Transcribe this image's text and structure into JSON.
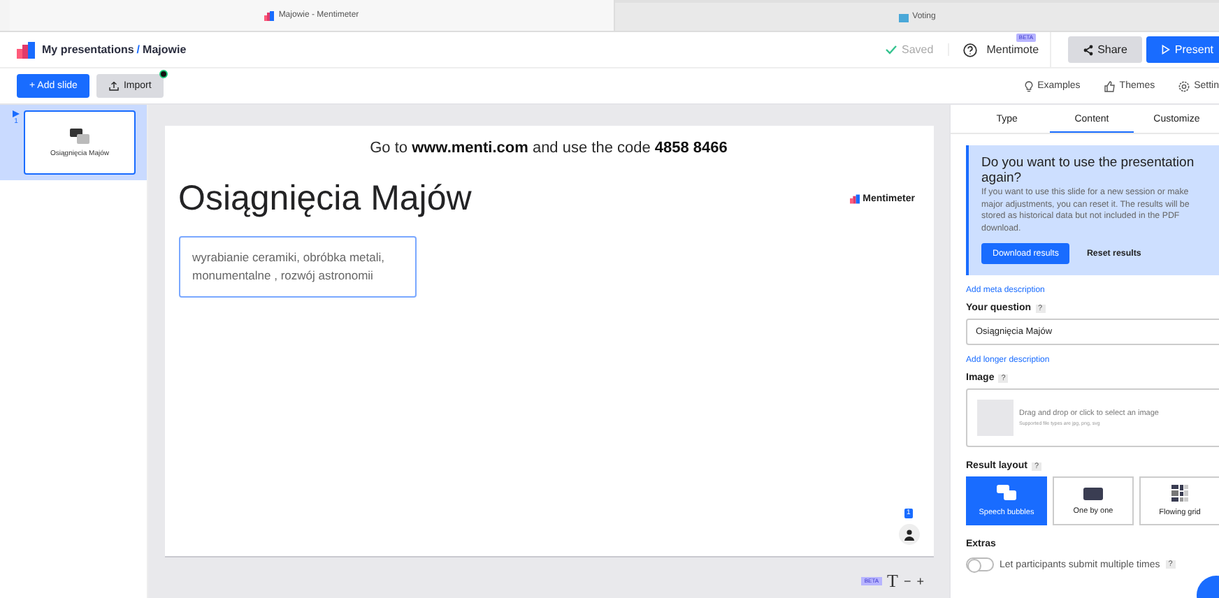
{
  "browser_tabs": [
    {
      "title": "Majowie - Mentimeter",
      "selected": true
    },
    {
      "title": "Voting",
      "selected": false
    }
  ],
  "header": {
    "breadcrumb": "My presentations",
    "separator": "/",
    "presentation": "Majowie",
    "status": "Saved",
    "assistant": "Mentimote",
    "assistant_badge": "BETA",
    "share": "Share",
    "present": "Present"
  },
  "toolbar": {
    "add_slide": "+ Add slide",
    "import": "Import",
    "import_notification": true,
    "links": [
      "Examples",
      "Themes",
      "Settin"
    ]
  },
  "slides": [
    {
      "number": "1",
      "title": "Osiągnięcia Majów",
      "selected": true
    }
  ],
  "slide": {
    "instruction": "Go to **www.menti.com** and use the code **4858 8466**",
    "title": "Osiągnięcia Majów",
    "text": "wyrabianie ceramiki, obróbka metali, monumentalne , rozwój astronomii",
    "brand": "Mentimeter",
    "participants": "1"
  },
  "canvas_tools": {
    "badge": "BETA",
    "text_tool": "T",
    "minus": "−",
    "plus": "+"
  },
  "panel": {
    "tabs": [
      {
        "label": "Type",
        "selected": false
      },
      {
        "label": "Content",
        "selected": true
      },
      {
        "label": "Customize",
        "selected": false
      }
    ],
    "notice": {
      "title": "Do you want to use the presentation again?",
      "body": "If you want to use this slide for a new session or make major adjustments, you can reset it. The results will be stored as historical data but not included in the PDF download.",
      "primary": "Download results",
      "secondary": "Reset results"
    },
    "meta_link": "Add meta description",
    "question_label": "Your question",
    "question_help": "?",
    "question_value": "Osiągnięcia Majów",
    "description_link": "Add longer description",
    "image_label": "Image",
    "image_help": "?",
    "image_hint": "Drag and drop or click to select an image",
    "image_types": "Supported file types are jpg, png, svg",
    "layout_label": "Result layout",
    "layout_help": "?",
    "layouts": [
      {
        "kind": "bubbles",
        "label": "Speech bubbles",
        "selected": true
      },
      {
        "kind": "single",
        "label": "One by one",
        "selected": false
      },
      {
        "kind": "grid",
        "label": "Flowing grid",
        "selected": false
      }
    ],
    "extras_label": "Extras",
    "extras": [
      {
        "label": "Let participants submit multiple times",
        "help": "?",
        "checked": false
      }
    ]
  }
}
